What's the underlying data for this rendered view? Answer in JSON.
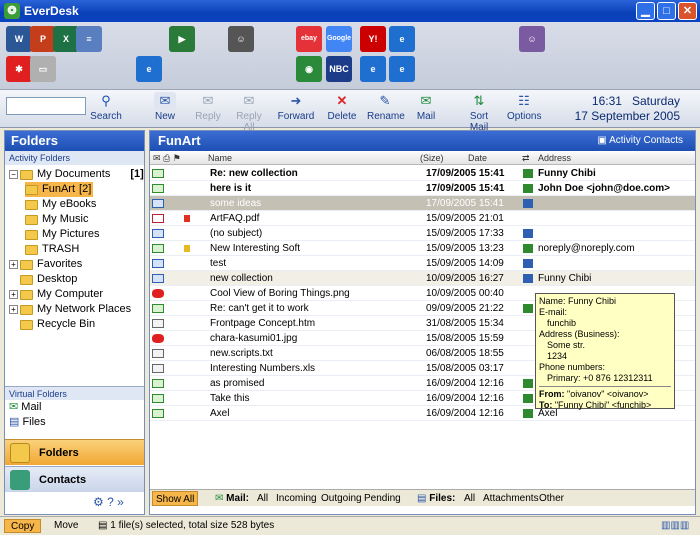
{
  "window": {
    "title": "EverDesk"
  },
  "launch_icons": [
    {
      "name": "word-icon",
      "text": "W",
      "color": "#2b5797"
    },
    {
      "name": "powerpoint-icon",
      "text": "P",
      "color": "#c43e1c"
    },
    {
      "name": "excel-icon",
      "text": "X",
      "color": "#1e7145"
    },
    {
      "name": "notepad-icon",
      "text": "≡",
      "color": "#5a7fc0"
    },
    {
      "name": "paint-icon",
      "text": "✱",
      "color": "#e02020"
    },
    {
      "name": "document-icon",
      "text": "▭",
      "color": "#b0b0b0"
    },
    {
      "name": "media-player-icon",
      "text": "▶",
      "color": "#2a7a3a"
    },
    {
      "name": "einstein-icon",
      "text": "☺",
      "color": "#555"
    },
    {
      "name": "internet-explorer-icon",
      "text": "e",
      "color": "#1e6fd0"
    },
    {
      "name": "ebay-icon",
      "text": "ebay",
      "color": "#e53238"
    },
    {
      "name": "google-icon",
      "text": "Google",
      "color": "#4285f4"
    },
    {
      "name": "yahoo-icon",
      "text": "Y!",
      "color": "#cc0000"
    },
    {
      "name": "ie-link-icon",
      "text": "e",
      "color": "#1e6fd0"
    },
    {
      "name": "world-icon",
      "text": "◉",
      "color": "#2a8a3a"
    },
    {
      "name": "msnbc-icon",
      "text": "NBC",
      "color": "#1c3c8a"
    },
    {
      "name": "ie-link-icon-2",
      "text": "e",
      "color": "#1e6fd0"
    },
    {
      "name": "ie-link-icon-3",
      "text": "e",
      "color": "#1e6fd0"
    },
    {
      "name": "anime-icon",
      "text": "☺",
      "color": "#7a5aa0"
    }
  ],
  "toolbar": {
    "search": "Search",
    "new": "New",
    "reply": "Reply",
    "reply_all": "Reply All",
    "forward": "Forward",
    "delete": "Delete",
    "rename": "Rename",
    "mail": "Mail",
    "sort_mail": "Sort Mail",
    "options": "Options"
  },
  "clock": {
    "time": "16:31",
    "day": "Saturday",
    "date": "17 September 2005"
  },
  "sidebar": {
    "title": "Folders",
    "activity_label": "Activity Folders",
    "tree": [
      {
        "label": "My Documents",
        "count": "[1]",
        "level": 0,
        "exp": "−"
      },
      {
        "label": "FunArt",
        "count": "[2]",
        "level": 1,
        "selected": true
      },
      {
        "label": "My eBooks",
        "level": 1
      },
      {
        "label": "My Music",
        "level": 1
      },
      {
        "label": "My Pictures",
        "level": 1
      },
      {
        "label": "TRASH",
        "level": 1
      },
      {
        "label": "Favorites",
        "level": 0,
        "exp": "+"
      },
      {
        "label": "Desktop",
        "level": 0
      },
      {
        "label": "My Computer",
        "level": 0,
        "exp": "+"
      },
      {
        "label": "My Network Places",
        "level": 0,
        "exp": "+"
      },
      {
        "label": "Recycle Bin",
        "level": 0
      }
    ],
    "virtual_label": "Virtual Folders",
    "virtual": [
      "Mail",
      "Files"
    ],
    "tab_folders": "Folders",
    "tab_contacts": "Contacts"
  },
  "main": {
    "title": "FunArt",
    "activity_contacts": "Activity Contacts",
    "columns": {
      "name": "Name",
      "size": "(Size)",
      "date": "Date",
      "address": "Address"
    },
    "rows": [
      {
        "icon": "mail",
        "name": "Re: new collection",
        "date": "17/09/2005 15:41",
        "addr": "Funny Chibi",
        "bold": true
      },
      {
        "icon": "mail",
        "name": "here is it",
        "date": "17/09/2005 15:41",
        "addr": "John Doe <john@doe.com>",
        "bold": true
      },
      {
        "icon": "blue",
        "name": "some ideas",
        "date": "17/09/2005 15:41",
        "addr": "",
        "sel": true
      },
      {
        "icon": "doc",
        "name": "ArtFAQ.pdf",
        "date": "15/09/2005 21:01",
        "addr": "",
        "flag": "#e03020"
      },
      {
        "icon": "blue",
        "name": "(no subject)",
        "date": "15/09/2005 17:33",
        "addr": ""
      },
      {
        "icon": "mail",
        "name": "New Interesting Soft",
        "date": "15/09/2005 13:23",
        "addr": "noreply@noreply.com",
        "flag": "#e8b820"
      },
      {
        "icon": "blue",
        "name": "test",
        "date": "15/09/2005 14:09",
        "addr": ""
      },
      {
        "icon": "blue",
        "name": "new collection",
        "date": "10/09/2005 16:27",
        "addr": "Funny Chibi",
        "hl": true
      },
      {
        "icon": "img",
        "name": "Cool View of Boring Things.png",
        "date": "10/09/2005 00:40",
        "addr": ""
      },
      {
        "icon": "mail",
        "name": "Re: can't get it to work",
        "date": "09/09/2005 21:22",
        "addr": ""
      },
      {
        "icon": "png",
        "name": "Frontpage Concept.htm",
        "date": "31/08/2005 15:34",
        "addr": ""
      },
      {
        "icon": "img",
        "name": "chara-kasumi01.jpg",
        "date": "15/08/2005 15:59",
        "addr": ""
      },
      {
        "icon": "png",
        "name": "new.scripts.txt",
        "date": "06/08/2005 18:55",
        "addr": ""
      },
      {
        "icon": "png",
        "name": "Interesting Numbers.xls",
        "date": "15/08/2005 03:17",
        "addr": ""
      },
      {
        "icon": "mail",
        "name": "as promised",
        "date": "16/09/2004 12:16",
        "addr": ""
      },
      {
        "icon": "mail",
        "name": "Take this",
        "date": "16/09/2004 12:16",
        "addr": ""
      },
      {
        "icon": "mail",
        "name": "Axel",
        "date": "16/09/2004 12:16",
        "addr": "Axel"
      }
    ],
    "tooltip": {
      "name": "Name: Funny Chibi",
      "email_label": "E-mail:",
      "email": "funchib",
      "addr_label": "Address (Business):",
      "street": "Some str.",
      "num": "1234",
      "phone_label": "Phone numbers:",
      "phone": "Primary: +0 876 12312311",
      "from_label": "From:",
      "from": "\"oivanov\" <oivanov>",
      "to_label": "To:",
      "to": "\"Funny Chibi\" <funchib>"
    },
    "bottom_tabs": {
      "show_all": "Show All",
      "mail_label": "Mail:",
      "all": "All",
      "incoming": "Incoming",
      "outgoing": "Outgoing",
      "pending": "Pending",
      "files_label": "Files:",
      "all2": "All",
      "attachments": "Attachments",
      "other": "Other"
    }
  },
  "status": {
    "copy": "Copy",
    "move": "Move",
    "text": "1 file(s) selected, total size 528 bytes"
  }
}
